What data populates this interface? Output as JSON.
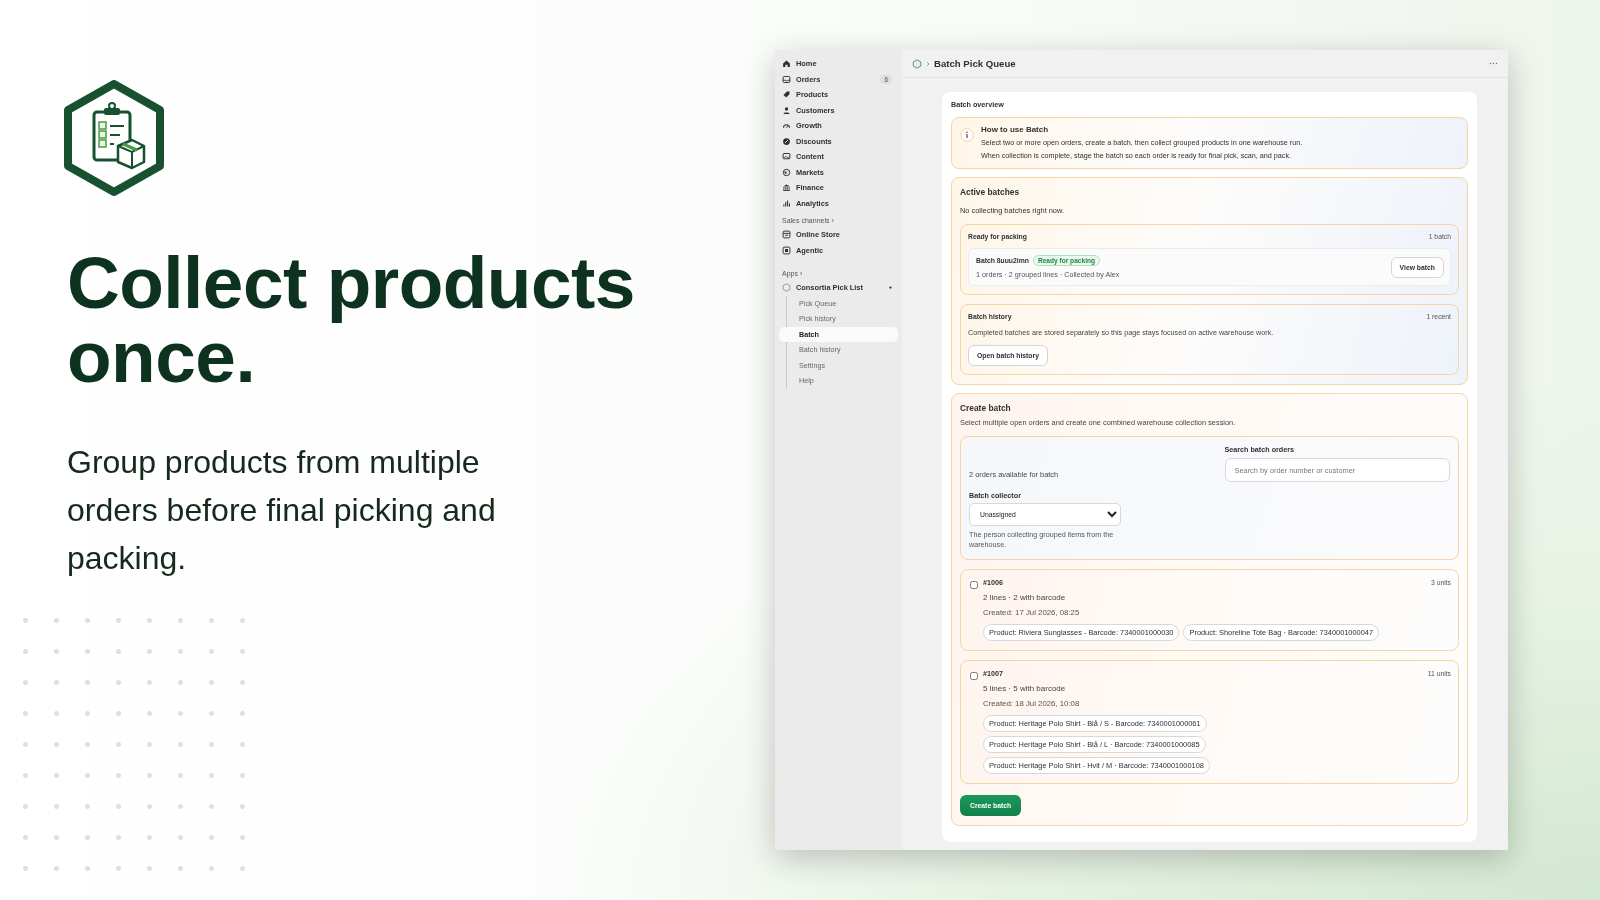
{
  "promo": {
    "headline": "Collect products once.",
    "subtext": "Group products from multiple orders before final picking and packing."
  },
  "sidebar": {
    "nav": [
      {
        "label": "Home"
      },
      {
        "label": "Orders",
        "badge": "6"
      },
      {
        "label": "Products"
      },
      {
        "label": "Customers"
      },
      {
        "label": "Growth"
      },
      {
        "label": "Discounts"
      },
      {
        "label": "Content"
      },
      {
        "label": "Markets"
      },
      {
        "label": "Finance"
      },
      {
        "label": "Analytics"
      }
    ],
    "sales_channels": {
      "heading": "Sales channels ›",
      "items": [
        {
          "label": "Online Store"
        },
        {
          "label": "Agentic"
        }
      ]
    },
    "apps": {
      "heading": "Apps ›",
      "app": {
        "label": "Consortia Pick List",
        "pages": [
          {
            "label": "Pick Queue",
            "selected": false
          },
          {
            "label": "Pick history",
            "selected": false
          },
          {
            "label": "Batch",
            "selected": true
          },
          {
            "label": "Batch history",
            "selected": false
          },
          {
            "label": "Settings",
            "selected": false
          },
          {
            "label": "Help",
            "selected": false
          }
        ]
      }
    }
  },
  "header": {
    "title": "Batch Pick Queue"
  },
  "overview": {
    "label": "Batch overview",
    "info": {
      "title": "How to use Batch",
      "lines": [
        "Select two or more open orders, create a batch, then collect grouped products in one warehouse run.",
        "When collection is complete, stage the batch so each order is ready for final pick, scan, and pack."
      ]
    },
    "active": {
      "title": "Active batches",
      "empty": "No collecting batches right now.",
      "ready": {
        "title": "Ready for packing",
        "count": "1 batch",
        "batch": {
          "name": "Batch 8uuu2imn",
          "status": "Ready for packing",
          "meta": "1 orders · 2 grouped lines · Collected by Alex",
          "button": "View batch"
        }
      },
      "history": {
        "title": "Batch history",
        "count": "1 recent",
        "text": "Completed batches are stored separately so this page stays focused on active warehouse work.",
        "button": "Open batch history"
      }
    },
    "create": {
      "title": "Create batch",
      "description": "Select multiple open orders and create one combined warehouse collection session.",
      "available": "2 orders available for batch",
      "search": {
        "label": "Search batch orders",
        "placeholder": "Search by order number or customer"
      },
      "collector": {
        "label": "Batch collector",
        "value": "Unassigned",
        "help": "The person collecting grouped items from the warehouse."
      },
      "orders": [
        {
          "number": "#1006",
          "units": "3 units",
          "lines": "2 lines · 2 with barcode",
          "created": "Created: 17 Jul 2026, 08:25",
          "checked": false,
          "products": [
            "Product: Riviera Sunglasses - Barcode: 7340001000030",
            "Product: Shoreline Tote Bag · Barcode: 7340001000047"
          ]
        },
        {
          "number": "#1007",
          "units": "11 units",
          "lines": "5 lines · 5 with barcode",
          "created": "Created: 18 Jul 2026, 10:08",
          "checked": false,
          "products": [
            "Product: Heritage Polo Shirt - Blå / S - Barcode: 7340001000061",
            "Product: Heritage Polo Shirt - Blå / L · Barcode: 7340001000085",
            "Product: Heritage Polo Shirt - Hvit / M · Barcode: 7340001000108"
          ]
        }
      ],
      "button": "Create batch"
    }
  }
}
